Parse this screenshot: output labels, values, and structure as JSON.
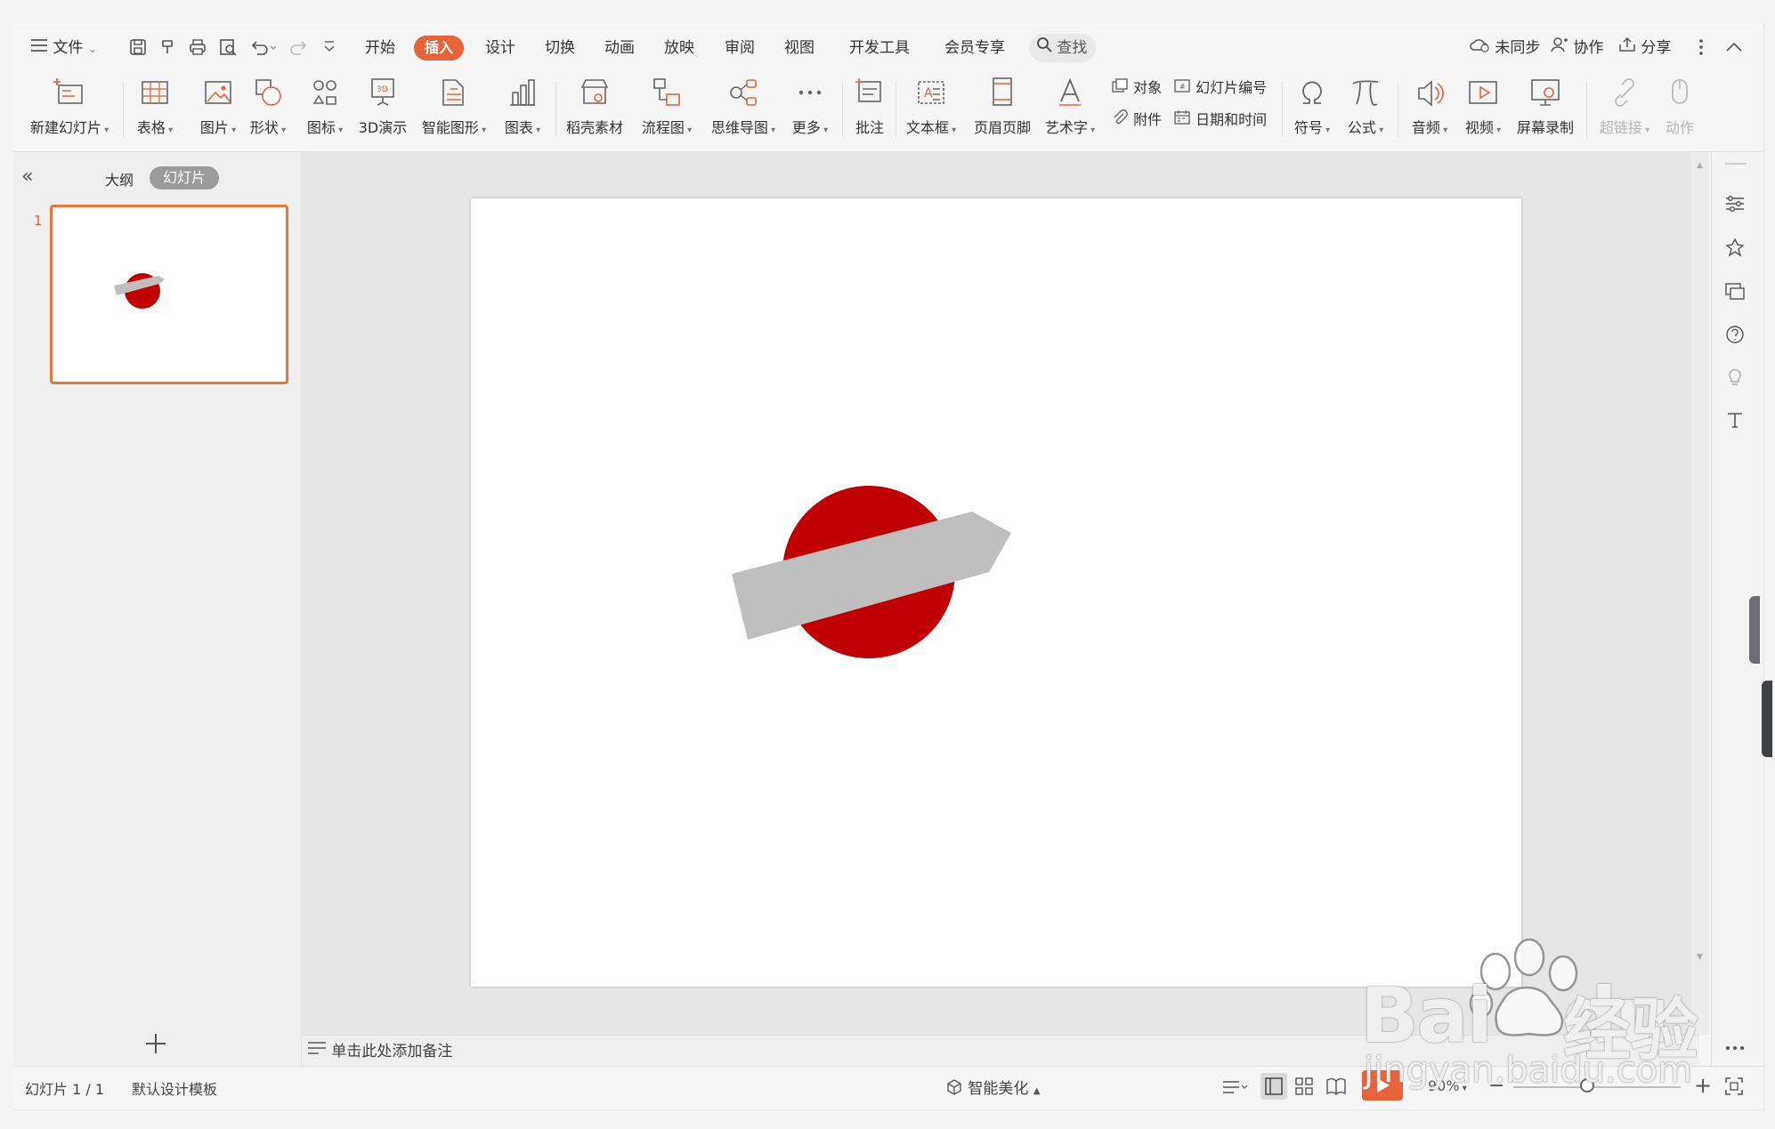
{
  "menu": {
    "file": "文件",
    "tabs": [
      "开始",
      "插入",
      "设计",
      "切换",
      "动画",
      "放映",
      "审阅",
      "视图",
      "开发工具",
      "会员专享"
    ],
    "active_tab": "插入",
    "search": "查找",
    "right": {
      "sync": "未同步",
      "collab": "协作",
      "share": "分享"
    }
  },
  "ribbon": {
    "new_slide": "新建幻灯片",
    "table": "表格",
    "picture": "图片",
    "shape": "形状",
    "icon": "图标",
    "demo3d": "3D演示",
    "smartart": "智能图形",
    "chart": "图表",
    "material": "稻壳素材",
    "flowchart": "流程图",
    "mindmap": "思维导图",
    "more": "更多",
    "comment": "批注",
    "textbox": "文本框",
    "header_footer": "页眉页脚",
    "wordart": "艺术字",
    "object": "对象",
    "attachment": "附件",
    "slide_number": "幻灯片编号",
    "datetime": "日期和时间",
    "symbol": "符号",
    "formula": "公式",
    "audio": "音频",
    "video": "视频",
    "screen_record": "屏幕录制",
    "hyperlink": "超链接",
    "action": "动作"
  },
  "panel": {
    "outline_tab": "大纲",
    "slides_tab": "幻灯片",
    "slide_index": "1"
  },
  "notes_placeholder": "单击此处添加备注",
  "status": {
    "slide_count": "幻灯片 1 / 1",
    "template": "默认设计模板",
    "beautify": "智能美化",
    "zoom": "90%"
  },
  "watermark": {
    "brand": "Bai",
    "brand_end": "du",
    "cn": "经验",
    "url": "jingyan.baidu.com"
  },
  "colors": {
    "accent": "#e8623a",
    "circle": "#c00000",
    "banner": "#bfbfbf"
  }
}
